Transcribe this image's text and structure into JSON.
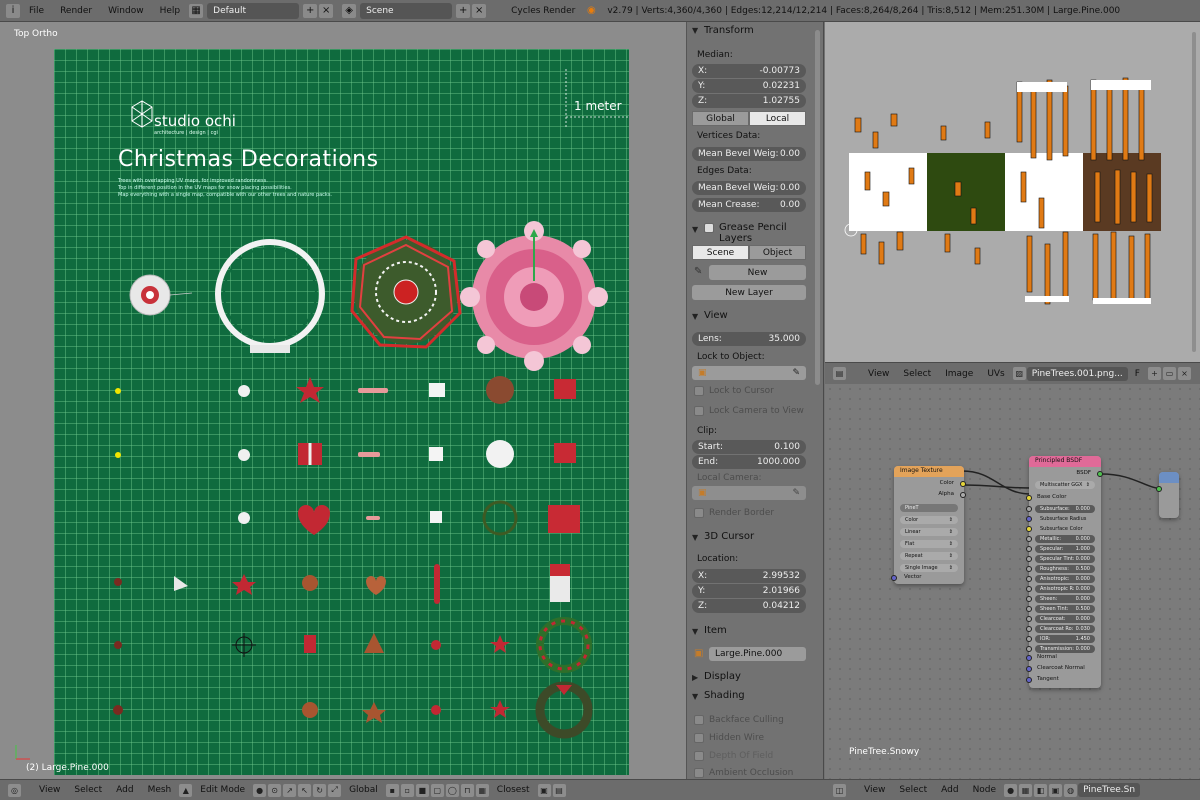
{
  "topbar": {
    "menus": [
      "File",
      "Render",
      "Window",
      "Help"
    ],
    "layout": "Default",
    "scene": "Scene",
    "engine": "Cycles Render",
    "stats": "v2.79 | Verts:4,360/4,360 | Edges:12,214/12,214 | Faces:8,264/8,264 | Tris:8,512 | Mem:251.30M | Large.Pine.000"
  },
  "viewport": {
    "title": "Top Ortho",
    "status": "(2) Large.Pine.000",
    "meter_label": "1 meter",
    "logo": "studio ochi",
    "logo_sub": "architecture | design | cgi",
    "heading": "Christmas Decorations",
    "desc_lines": [
      "Trees with overlapping UV maps, for improved randomness.",
      "Top in different position in the UV maps for snow placing possibilities.",
      "Map everything with a single map, compatible with our other trees and nature packs."
    ]
  },
  "viewport_header": {
    "items": [
      "View",
      "Select",
      "Add",
      "Mesh"
    ],
    "mode": "Edit Mode",
    "orientation": "Global",
    "snap": "Closest"
  },
  "properties": {
    "transform": {
      "title": "Transform",
      "median_label": "Median:",
      "x": {
        "label": "X:",
        "value": "-0.00773"
      },
      "y": {
        "label": "Y:",
        "value": "0.02231"
      },
      "z": {
        "label": "Z:",
        "value": "1.02755"
      },
      "global": "Global",
      "local": "Local",
      "vertices_data": "Vertices Data:",
      "mean_bevel_v": {
        "label": "Mean Bevel Weig:",
        "value": "0.00"
      },
      "edges_data": "Edges Data:",
      "mean_bevel_e": {
        "label": "Mean Bevel Weig:",
        "value": "0.00"
      },
      "mean_crease": {
        "label": "Mean Crease:",
        "value": "0.00"
      }
    },
    "grease": {
      "title": "Grease Pencil Layers",
      "scene": "Scene",
      "object": "Object",
      "new": "New",
      "new_layer": "New Layer"
    },
    "view": {
      "title": "View",
      "lens": {
        "label": "Lens:",
        "value": "35.000"
      },
      "lock_object": "Lock to Object:",
      "lock_cursor": "Lock to Cursor",
      "lock_camera": "Lock Camera to View",
      "clip": "Clip:",
      "start": {
        "label": "Start:",
        "value": "0.100"
      },
      "end": {
        "label": "End:",
        "value": "1000.000"
      },
      "local_camera": "Local Camera:",
      "render_border": "Render Border"
    },
    "cursor": {
      "title": "3D Cursor",
      "location": "Location:",
      "x": {
        "label": "X:",
        "value": "2.99532"
      },
      "y": {
        "label": "Y:",
        "value": "2.01966"
      },
      "z": {
        "label": "Z:",
        "value": "0.04212"
      }
    },
    "item": {
      "title": "Item",
      "name": "Large.Pine.000"
    },
    "display": {
      "title": "Display"
    },
    "shading": {
      "title": "Shading",
      "backface": "Backface Culling",
      "hidden_wire": "Hidden Wire",
      "depth_field": "Depth Of Field",
      "ambient": "Ambient Occlusion"
    }
  },
  "uv_header": {
    "items": [
      "View",
      "Select",
      "Image",
      "UVs"
    ],
    "image_name": "PineTrees.001.png...",
    "f_label": "F"
  },
  "node_editor": {
    "material_label": "PineTree.Snowy",
    "image_texture": {
      "title": "Image Texture",
      "out_color": "Color",
      "out_alpha": "Alpha",
      "image": "PineT",
      "color": "Color",
      "linear": "Linear",
      "flat": "Flat",
      "repeat": "Repeat",
      "single": "Single Image",
      "vector": "Vector"
    },
    "bsdf": {
      "title": "Principled BSDF",
      "out": "BSDF",
      "distribution": "Multiscatter GGX",
      "base_color": "Base Color",
      "fields": [
        {
          "label": "Subsurface:",
          "value": "0.000"
        },
        {
          "label": "Subsurface Radius",
          "value": ""
        },
        {
          "label": "Subsurface Color",
          "value": ""
        },
        {
          "label": "Metallic:",
          "value": "0.000"
        },
        {
          "label": "Specular:",
          "value": "1.000"
        },
        {
          "label": "Specular Tint:",
          "value": "0.000"
        },
        {
          "label": "Roughness:",
          "value": "0.500"
        },
        {
          "label": "Anisotropic:",
          "value": "0.000"
        },
        {
          "label": "Anisotropic R:",
          "value": "0.000"
        },
        {
          "label": "Sheen:",
          "value": "0.000"
        },
        {
          "label": "Sheen Tint:",
          "value": "0.500"
        },
        {
          "label": "Clearcoat:",
          "value": "0.000"
        },
        {
          "label": "Clearcoat Ro:",
          "value": "0.030"
        },
        {
          "label": "IOR:",
          "value": "1.450"
        },
        {
          "label": "Transmission:",
          "value": "0.000"
        }
      ],
      "normal": "Normal",
      "clearcoat_normal": "Clearcoat Normal",
      "tangent": "Tangent"
    }
  },
  "node_header": {
    "items": [
      "View",
      "Select",
      "Add",
      "Node"
    ],
    "material": "PineTree.Sn"
  },
  "colors": {
    "board": "#0f6b3e",
    "panel": "#727272",
    "header": "#6c6c6c",
    "image_texture_head": "#e3a35a",
    "bsdf_head": "#e06a98"
  }
}
